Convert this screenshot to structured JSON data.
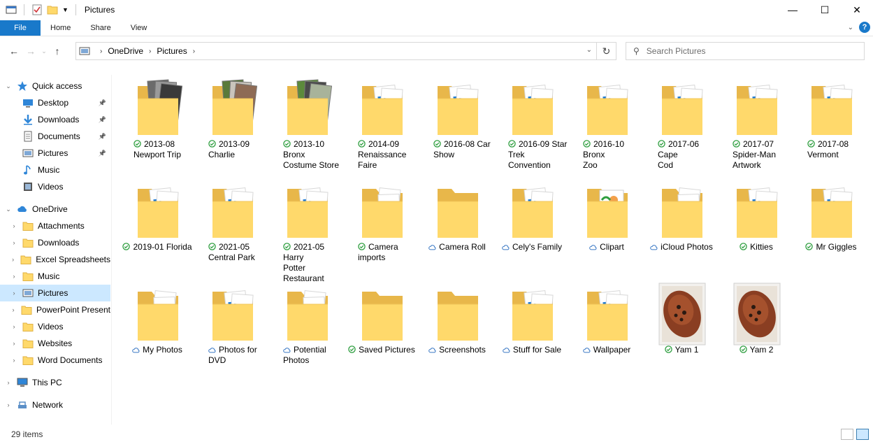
{
  "window": {
    "title": "Pictures"
  },
  "ribbon": {
    "tabs": [
      "File",
      "Home",
      "Share",
      "View"
    ]
  },
  "address": {
    "path": [
      "OneDrive",
      "Pictures"
    ]
  },
  "search": {
    "placeholder": "Search Pictures"
  },
  "nav": {
    "items": [
      {
        "label": "Quick access",
        "icon": "star-icon",
        "level": 0,
        "expanded": true
      },
      {
        "label": "Desktop",
        "icon": "desktop-icon",
        "level": 1,
        "pinned": true
      },
      {
        "label": "Downloads",
        "icon": "download-icon",
        "level": 1,
        "pinned": true
      },
      {
        "label": "Documents",
        "icon": "documents-icon",
        "level": 1,
        "pinned": true
      },
      {
        "label": "Pictures",
        "icon": "pictures-icon",
        "level": 1,
        "pinned": true
      },
      {
        "label": "Music",
        "icon": "music-icon",
        "level": 1
      },
      {
        "label": "Videos",
        "icon": "videos-icon",
        "level": 1
      },
      {
        "label": "OneDrive",
        "icon": "cloud-icon",
        "level": 0,
        "expanded": true
      },
      {
        "label": "Attachments",
        "icon": "folder-icon",
        "level": 1,
        "expandable": true
      },
      {
        "label": "Downloads",
        "icon": "folder-icon",
        "level": 1,
        "expandable": true
      },
      {
        "label": "Excel Spreadsheets",
        "icon": "folder-icon",
        "level": 1,
        "expandable": true
      },
      {
        "label": "Music",
        "icon": "folder-icon",
        "level": 1,
        "expandable": true
      },
      {
        "label": "Pictures",
        "icon": "pictures-icon",
        "level": 1,
        "expandable": true,
        "selected": true
      },
      {
        "label": "PowerPoint Present",
        "icon": "folder-icon",
        "level": 1,
        "expandable": true
      },
      {
        "label": "Videos",
        "icon": "folder-icon",
        "level": 1,
        "expandable": true
      },
      {
        "label": "Websites",
        "icon": "folder-icon",
        "level": 1,
        "expandable": true
      },
      {
        "label": "Word Documents",
        "icon": "folder-icon",
        "level": 1,
        "expandable": true
      },
      {
        "label": "This PC",
        "icon": "computer-icon",
        "level": 0,
        "expandable": true
      },
      {
        "label": "Network",
        "icon": "network-icon",
        "level": 0,
        "expandable": true
      }
    ]
  },
  "items": [
    {
      "lines": [
        "2013-08",
        "Newport Trip"
      ],
      "status": "synced",
      "kind": "photo-folder",
      "colors": [
        "#6b6b6b",
        "#9a9a9a",
        "#3a3a3a"
      ]
    },
    {
      "lines": [
        "2013-09",
        "Charlie"
      ],
      "status": "synced",
      "kind": "photo-folder",
      "colors": [
        "#5a7a3a",
        "#c9c4bc",
        "#8e6b55"
      ]
    },
    {
      "lines": [
        "2013-10 Bronx",
        "Costume Store"
      ],
      "status": "synced",
      "kind": "photo-folder",
      "colors": [
        "#5c8a3b",
        "#4a4a4a",
        "#a8b39a"
      ]
    },
    {
      "lines": [
        "2014-09",
        "Renaissance",
        "Faire"
      ],
      "status": "synced",
      "kind": "image-folder"
    },
    {
      "lines": [
        "2016-08 Car",
        "Show"
      ],
      "status": "synced",
      "kind": "image-folder"
    },
    {
      "lines": [
        "2016-09 Star",
        "Trek",
        "Convention"
      ],
      "status": "synced",
      "kind": "image-folder"
    },
    {
      "lines": [
        "2016-10 Bronx",
        "Zoo"
      ],
      "status": "synced",
      "kind": "image-folder"
    },
    {
      "lines": [
        "2017-06 Cape",
        "Cod"
      ],
      "status": "synced",
      "kind": "image-folder"
    },
    {
      "lines": [
        "2017-07",
        "Spider-Man",
        "Artwork"
      ],
      "status": "synced",
      "kind": "image-folder"
    },
    {
      "lines": [
        "2017-08",
        "Vermont"
      ],
      "status": "synced",
      "kind": "image-folder"
    },
    {
      "lines": [
        "2019-01 Florida"
      ],
      "status": "synced",
      "kind": "image-folder"
    },
    {
      "lines": [
        "2021-05",
        "Central Park"
      ],
      "status": "synced",
      "kind": "image-folder"
    },
    {
      "lines": [
        "2021-05 Harry",
        "Potter",
        "Restaurant"
      ],
      "status": "synced",
      "kind": "image-folder"
    },
    {
      "lines": [
        "Camera",
        "imports"
      ],
      "status": "synced",
      "kind": "doc-folder"
    },
    {
      "lines": [
        "Camera Roll"
      ],
      "status": "cloud",
      "kind": "empty-folder"
    },
    {
      "lines": [
        "Cely's Family"
      ],
      "status": "cloud",
      "kind": "image-folder"
    },
    {
      "lines": [
        "Clipart"
      ],
      "status": "cloud",
      "kind": "clipart-folder"
    },
    {
      "lines": [
        "iCloud Photos"
      ],
      "status": "cloud",
      "kind": "doc-folder"
    },
    {
      "lines": [
        "Kitties"
      ],
      "status": "synced",
      "kind": "image-folder"
    },
    {
      "lines": [
        "Mr Giggles"
      ],
      "status": "synced",
      "kind": "image-folder"
    },
    {
      "lines": [
        "My Photos"
      ],
      "status": "cloud",
      "kind": "doc-folder"
    },
    {
      "lines": [
        "Photos for",
        "DVD"
      ],
      "status": "cloud",
      "kind": "image-folder"
    },
    {
      "lines": [
        "Potential",
        "Photos"
      ],
      "status": "cloud",
      "kind": "doc-folder"
    },
    {
      "lines": [
        "Saved Pictures"
      ],
      "status": "synced",
      "kind": "empty-folder"
    },
    {
      "lines": [
        "Screenshots"
      ],
      "status": "cloud",
      "kind": "empty-folder"
    },
    {
      "lines": [
        "Stuff for Sale"
      ],
      "status": "cloud",
      "kind": "image-folder"
    },
    {
      "lines": [
        "Wallpaper"
      ],
      "status": "cloud",
      "kind": "image-folder"
    },
    {
      "lines": [
        "Yam 1"
      ],
      "status": "synced",
      "kind": "photo"
    },
    {
      "lines": [
        "Yam 2"
      ],
      "status": "synced",
      "kind": "photo"
    }
  ],
  "status": {
    "count": "29 items"
  },
  "colors": {
    "accent": "#1979ca",
    "folder": "#ffd96b",
    "folder_dark": "#e8b74a",
    "synced": "#2e9e3f",
    "cloud": "#3a78c4",
    "selection": "#cce8ff"
  }
}
